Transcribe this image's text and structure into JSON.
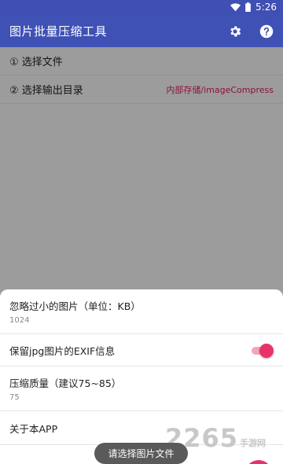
{
  "status_bar": {
    "time": "5:26",
    "wifi_icon": "wifi-icon",
    "battery_icon": "battery-icon"
  },
  "app_bar": {
    "title": "图片批量压缩工具",
    "settings_icon": "gear-icon",
    "help_icon": "help-icon"
  },
  "main": {
    "select_files": "① 选择文件",
    "select_output": "② 选择输出目录",
    "output_path": "内部存储/imageCompress"
  },
  "sheet": {
    "ignore_small_title": "忽略过小的图片（单位：KB）",
    "ignore_small_value": "1024",
    "keep_exif_title": "保留jpg图片的EXIF信息",
    "keep_exif_on": true,
    "quality_title": "压缩质量（建议75~85）",
    "quality_value": "75",
    "about_title": "关于本APP"
  },
  "toast": {
    "text": "请选择图片文件"
  },
  "watermark": {
    "number": "2265",
    "site": "手游网"
  },
  "colors": {
    "primary": "#3f51b5",
    "accent": "#e8326a",
    "path_text": "#d81b60"
  }
}
